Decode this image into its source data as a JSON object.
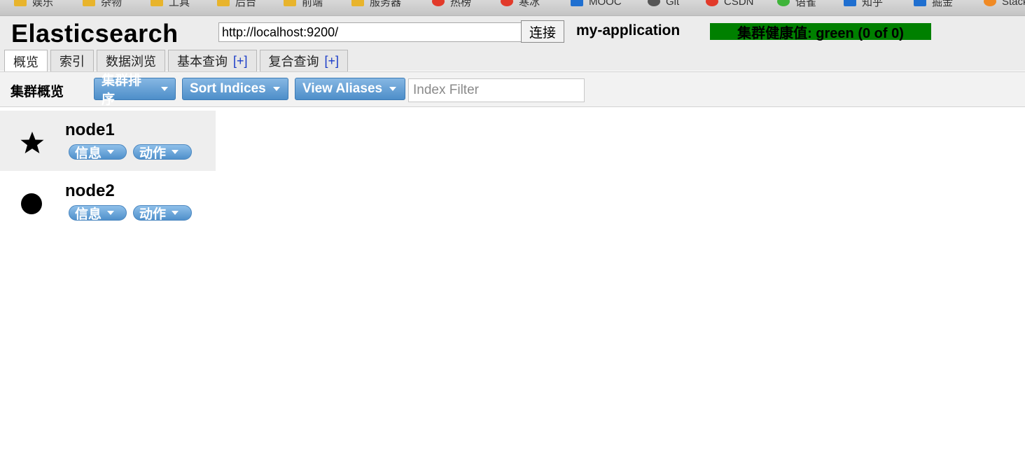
{
  "bookmarks": [
    "娱乐",
    "杂物",
    "工具",
    "后台",
    "前端",
    "服务器",
    "热榜",
    "寒冰",
    "MOOC",
    "Git",
    "CSDN",
    "语雀",
    "知乎",
    "掘金",
    "Stack"
  ],
  "header": {
    "brand": "Elasticsearch",
    "url_value": "http://localhost:9200/",
    "connect_label": "连接",
    "cluster_name": "my-application",
    "health_text": "集群健康值: green (0 of 0)",
    "health_color": "#008000"
  },
  "tabs": [
    {
      "label": "概览",
      "plus": ""
    },
    {
      "label": "索引",
      "plus": ""
    },
    {
      "label": "数据浏览",
      "plus": ""
    },
    {
      "label": "基本查询",
      "plus": "[+]"
    },
    {
      "label": "复合查询",
      "plus": "[+]"
    }
  ],
  "toolbar": {
    "title": "集群概览",
    "sort_cluster_label": "集群排序",
    "sort_indices_label": "Sort Indices",
    "view_aliases_label": "View Aliases",
    "filter_placeholder": "Index Filter",
    "accent": "#4d8ec9"
  },
  "nodes": [
    {
      "name": "node1",
      "icon": "star-icon",
      "info_label": "信息",
      "action_label": "动作"
    },
    {
      "name": "node2",
      "icon": "circle-icon",
      "info_label": "信息",
      "action_label": "动作"
    }
  ]
}
